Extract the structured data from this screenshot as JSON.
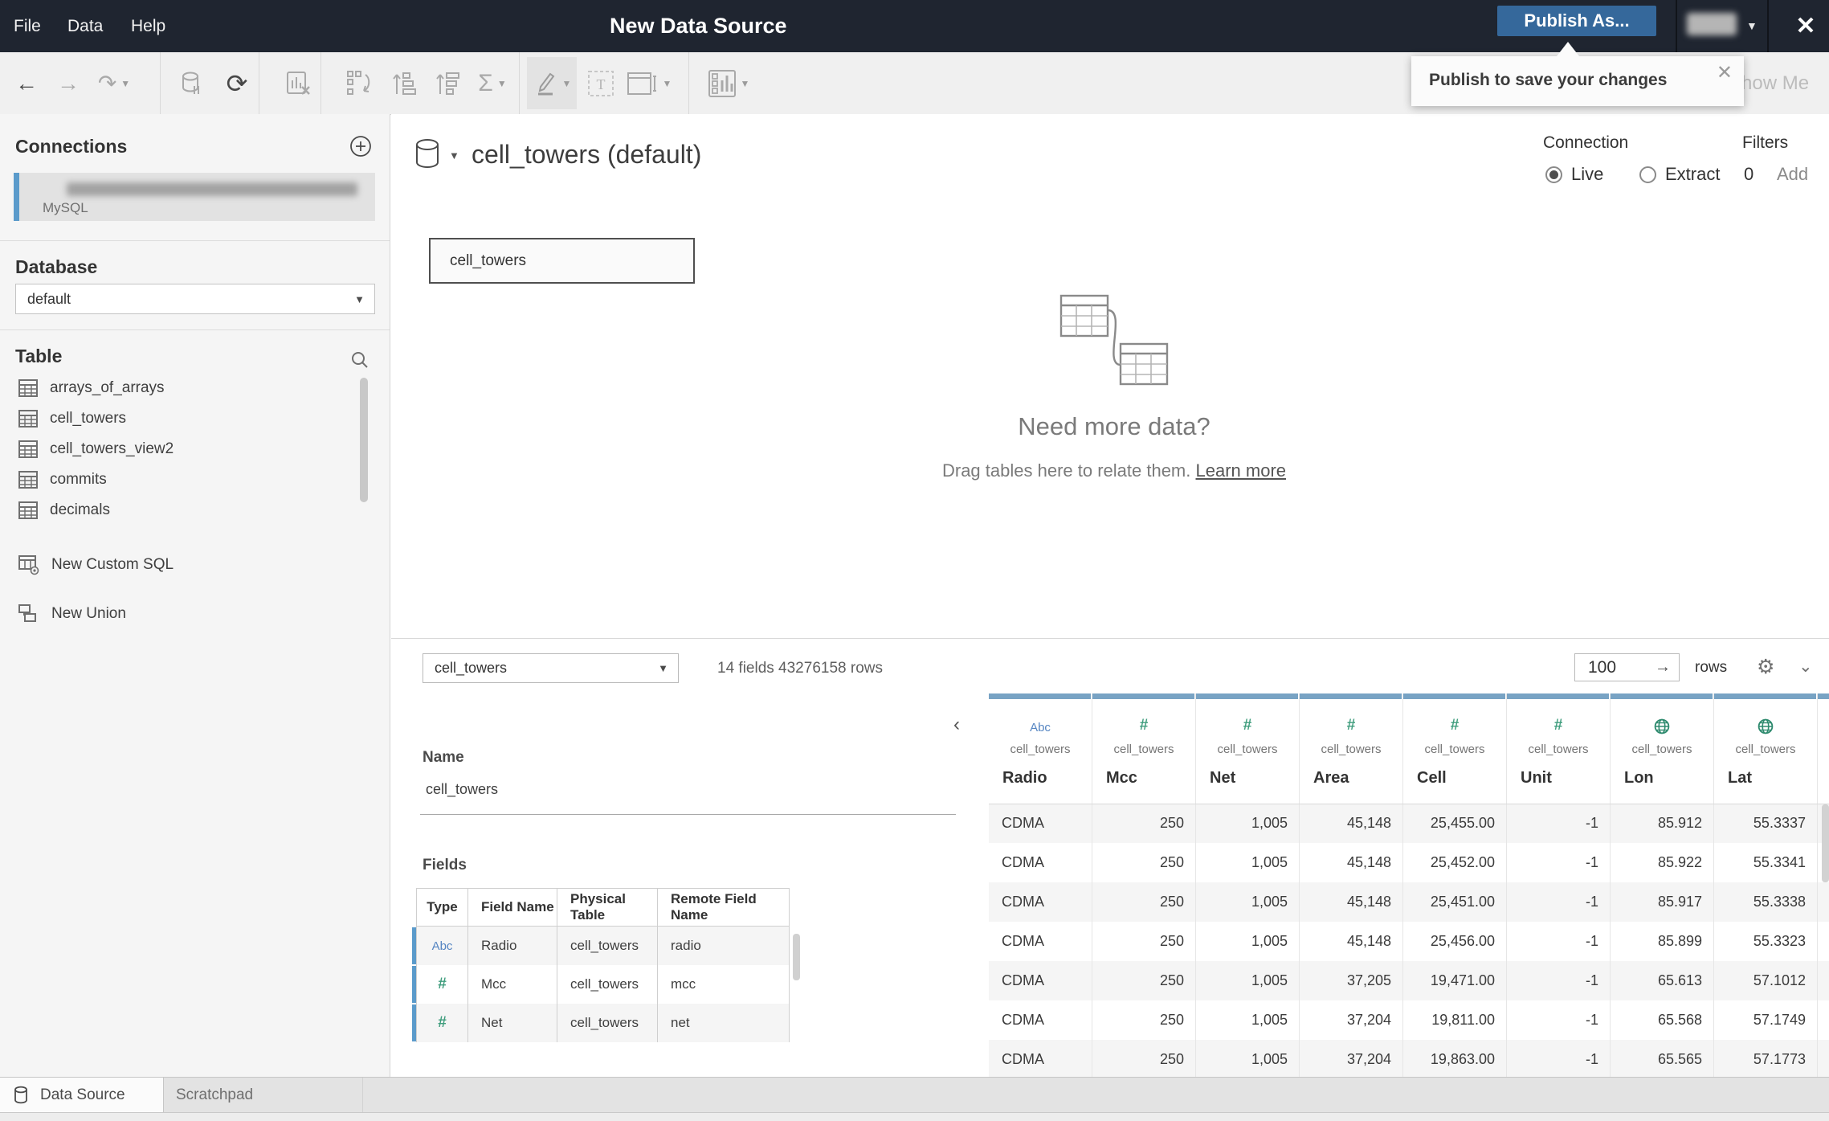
{
  "title_bar": {
    "title": "New Data Source",
    "menus": [
      "File",
      "Data",
      "Help"
    ],
    "publish_button": "Publish As...",
    "close_glyph": "✕"
  },
  "tooltip": {
    "text": "Publish to save your changes",
    "close_glyph": "✕"
  },
  "toolbar": {
    "show_me": "Show Me"
  },
  "sidebar": {
    "connections_header": "Connections",
    "connection": {
      "subtitle": "MySQL"
    },
    "database_header": "Database",
    "database_value": "default",
    "table_header": "Table",
    "tables": [
      "arrays_of_arrays",
      "cell_towers",
      "cell_towers_view2",
      "commits",
      "decimals"
    ],
    "actions": [
      {
        "label": "New Custom SQL",
        "icon": "custom-sql-icon"
      },
      {
        "label": "New Union",
        "icon": "union-icon"
      }
    ]
  },
  "canvas": {
    "datasource_title": "cell_towers (default)",
    "connection_label": "Connection",
    "live_label": "Live",
    "extract_label": "Extract",
    "filters_label": "Filters",
    "filters_count": "0",
    "filters_add": "Add",
    "node_label": "cell_towers",
    "empty_title": "Need more data?",
    "empty_hint": "Drag tables here to relate them.",
    "empty_link": "Learn more"
  },
  "meta_row": {
    "table_selector": "cell_towers",
    "summary": "14 fields 43276158 rows",
    "row_count": "100",
    "go_glyph": "→",
    "rows_label": "rows"
  },
  "fields_panel": {
    "name_label": "Name",
    "name_value": "cell_towers",
    "fields_label": "Fields",
    "columns": [
      "Type",
      "Field Name",
      "Physical Table",
      "Remote Field Name"
    ],
    "rows": [
      {
        "type": "Abc",
        "field": "Radio",
        "table": "cell_towers",
        "remote": "radio"
      },
      {
        "type": "#",
        "field": "Mcc",
        "table": "cell_towers",
        "remote": "mcc"
      },
      {
        "type": "#",
        "field": "Net",
        "table": "cell_towers",
        "remote": "net"
      }
    ]
  },
  "grid": {
    "source_table": "cell_towers",
    "columns": [
      {
        "name": "Radio",
        "type": "Abc"
      },
      {
        "name": "Mcc",
        "type": "#"
      },
      {
        "name": "Net",
        "type": "#"
      },
      {
        "name": "Area",
        "type": "#"
      },
      {
        "name": "Cell",
        "type": "#"
      },
      {
        "name": "Unit",
        "type": "#"
      },
      {
        "name": "Lon",
        "type": "globe"
      },
      {
        "name": "Lat",
        "type": "globe"
      }
    ],
    "rows": [
      [
        "CDMA",
        "250",
        "1,005",
        "45,148",
        "25,455.00",
        "-1",
        "85.912",
        "55.3337"
      ],
      [
        "CDMA",
        "250",
        "1,005",
        "45,148",
        "25,452.00",
        "-1",
        "85.922",
        "55.3341"
      ],
      [
        "CDMA",
        "250",
        "1,005",
        "45,148",
        "25,451.00",
        "-1",
        "85.917",
        "55.3338"
      ],
      [
        "CDMA",
        "250",
        "1,005",
        "45,148",
        "25,456.00",
        "-1",
        "85.899",
        "55.3323"
      ],
      [
        "CDMA",
        "250",
        "1,005",
        "37,205",
        "19,471.00",
        "-1",
        "65.613",
        "57.1012"
      ],
      [
        "CDMA",
        "250",
        "1,005",
        "37,204",
        "19,811.00",
        "-1",
        "65.568",
        "57.1749"
      ],
      [
        "CDMA",
        "250",
        "1,005",
        "37,204",
        "19,863.00",
        "-1",
        "65.565",
        "57.1773"
      ]
    ]
  },
  "footer": {
    "tabs": [
      {
        "label": "Data Source",
        "active": true
      },
      {
        "label": "Scratchpad",
        "active": false
      }
    ]
  },
  "colors": {
    "titlebar": "#1f2530",
    "publish_blue": "#35689b",
    "grid_header_blue": "#78a3c4",
    "type_green": "#3f9d7d",
    "type_blue": "#5585c2",
    "selection_blue": "#5b9bcb"
  }
}
